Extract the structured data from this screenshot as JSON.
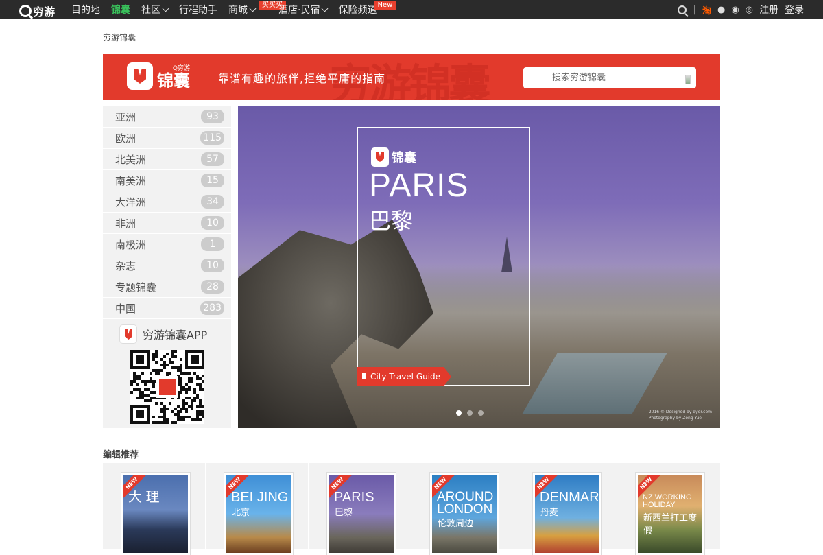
{
  "topbar": {
    "logo_text": "穷游",
    "nav": [
      {
        "label": "目的地",
        "active": false,
        "dropdown": false
      },
      {
        "label": "锦囊",
        "active": true,
        "dropdown": false
      },
      {
        "label": "社区",
        "active": false,
        "dropdown": true
      },
      {
        "label": "行程助手",
        "active": false,
        "dropdown": false
      },
      {
        "label": "商城",
        "active": false,
        "dropdown": true,
        "tag": "买买买"
      },
      {
        "label": "酒店·民宿",
        "active": false,
        "dropdown": true
      },
      {
        "label": "保险频道",
        "active": false,
        "dropdown": false,
        "tag": "New"
      }
    ],
    "right": {
      "taobao": "淘",
      "register": "注册",
      "login": "登录"
    }
  },
  "breadcrumb": "穷游锦囊",
  "banner": {
    "brand_small": "Q穷游",
    "brand_big": "锦囊",
    "slogan": "靠谱有趣的旅伴,拒绝平庸的指南",
    "search_placeholder": "搜索穷游锦囊",
    "colors": {
      "red": "#e23a2c"
    }
  },
  "regions": [
    {
      "name": "亚洲",
      "count": "93"
    },
    {
      "name": "欧洲",
      "count": "115"
    },
    {
      "name": "北美洲",
      "count": "57"
    },
    {
      "name": "南美洲",
      "count": "15"
    },
    {
      "name": "大洋洲",
      "count": "34"
    },
    {
      "name": "非洲",
      "count": "10"
    },
    {
      "name": "南极洲",
      "count": "1"
    },
    {
      "name": "杂志",
      "count": "10"
    },
    {
      "name": "专题锦囊",
      "count": "28"
    },
    {
      "name": "中国",
      "count": "283"
    }
  ],
  "app": {
    "label": "穷游锦囊APP"
  },
  "hero": {
    "brand": "锦囊",
    "title": "PARIS",
    "subtitle": "巴黎",
    "ribbon": "City Travel Guide",
    "credit_line1": "2016 © Designed by qyer.com",
    "credit_line2": "Photography by Zong Yue",
    "active_slide": 1,
    "slides": 3
  },
  "picks": {
    "title": "编辑推荐",
    "items": [
      {
        "new": "NEW",
        "title": "大 理",
        "subtitle": "",
        "bg": "linear-gradient(180deg,#4b6fae 0%,#6a88c0 45%,#2b3a5a 70%,#1a2030 100%)"
      },
      {
        "new": "NEW",
        "title": "BEI JING",
        "subtitle": "北京",
        "bg": "linear-gradient(180deg,#3f8fd6 0%,#69b3ea 50%,#b88a4a 80%,#6b3e20 100%)"
      },
      {
        "new": "NEW",
        "title": "PARIS",
        "subtitle": "巴黎",
        "bg": "linear-gradient(180deg,#6a5aa8 0%,#8a7cbc 50%,#6a665c 80%,#3f3b36 100%)"
      },
      {
        "new": "NEW",
        "title": "AROUND LONDON",
        "subtitle": "伦敦周边",
        "bg": "linear-gradient(180deg,#2c7fc3 0%,#5ea6dd 55%,#7a7668 80%,#4a4a40 100%)"
      },
      {
        "new": "NEW",
        "title": "DENMARK",
        "subtitle": "丹麦",
        "bg": "linear-gradient(180deg,#2e7cc4 0%,#6fb0e0 55%,#d8a040 78%,#b04030 100%)"
      },
      {
        "new": "NEW",
        "title": "NZ WORKING HOLIDAY",
        "subtitle": "新西兰打工度假",
        "bg": "linear-gradient(180deg,#c88a5a 0%,#e0b070 40%,#7a8a4a 70%,#3a4a2a 100%)"
      }
    ]
  }
}
